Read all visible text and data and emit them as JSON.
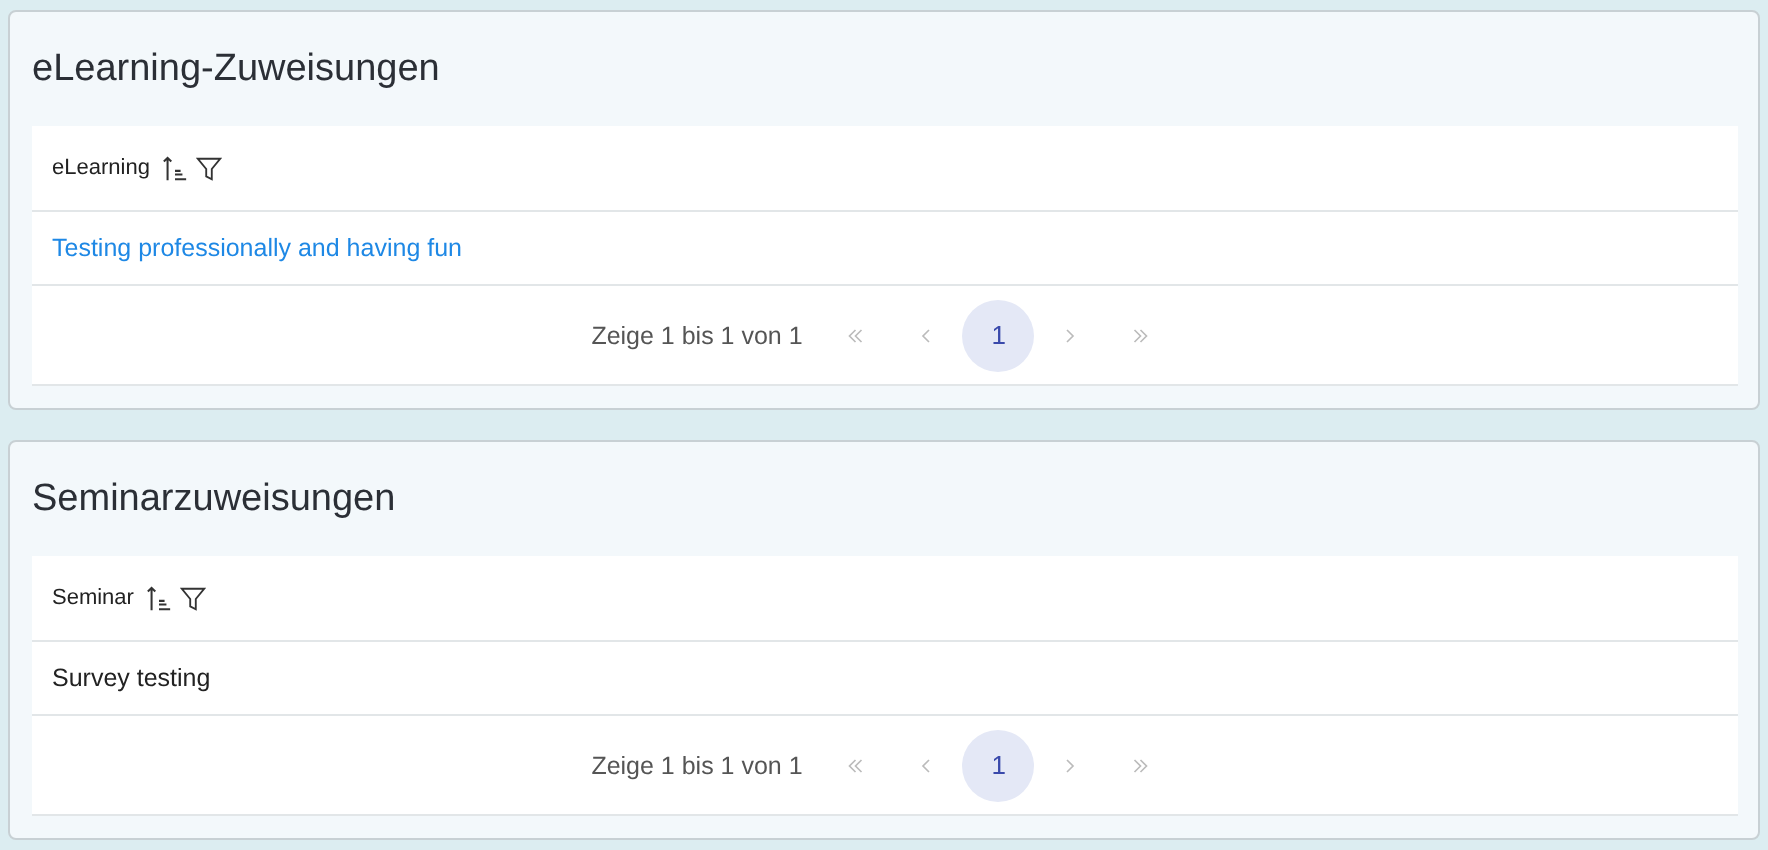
{
  "panels": [
    {
      "title": "eLearning-Zuweisungen",
      "column": {
        "label": "eLearning"
      },
      "rows": [
        {
          "text": "Testing professionally and having fun",
          "kind": "link"
        }
      ],
      "pager": {
        "summary": "Zeige 1 bis 1 von 1",
        "first_disabled": true,
        "prev_disabled": true,
        "pages": [
          {
            "label": "1",
            "selected": true
          }
        ],
        "next_disabled": true,
        "last_disabled": true
      }
    },
    {
      "title": "Seminarzuweisungen",
      "column": {
        "label": "Seminar"
      },
      "rows": [
        {
          "text": "Survey testing",
          "kind": "text"
        }
      ],
      "pager": {
        "summary": "Zeige 1 bis 1 von 1",
        "first_disabled": true,
        "prev_disabled": true,
        "pages": [
          {
            "label": "1",
            "selected": true
          }
        ],
        "next_disabled": true,
        "last_disabled": true
      }
    }
  ]
}
